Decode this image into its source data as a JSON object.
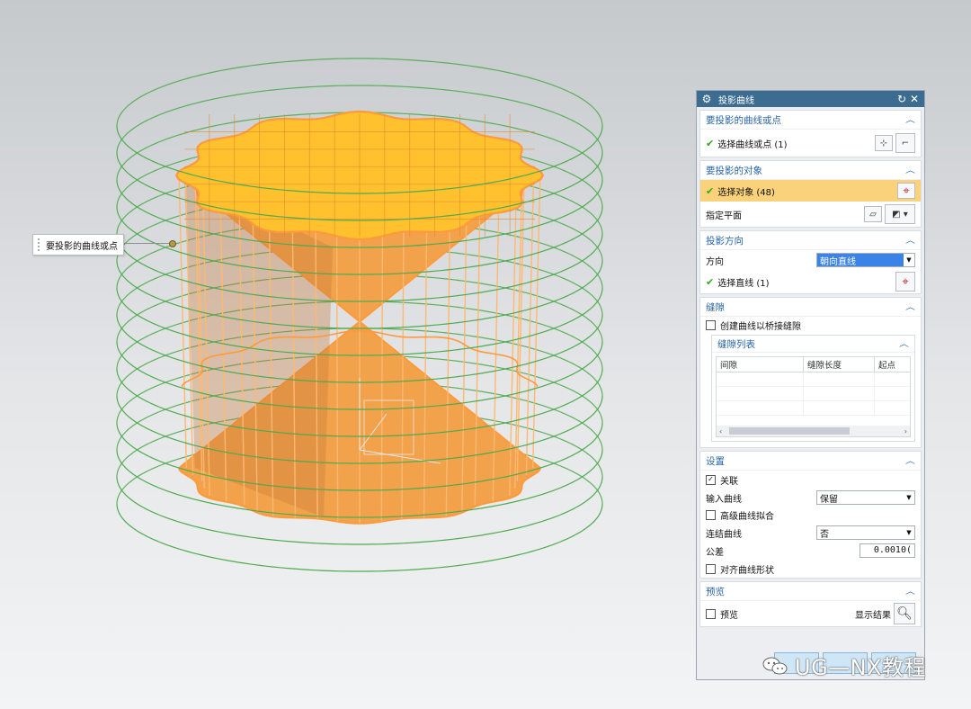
{
  "viewport": {
    "callout_label": "要投影的曲线或点",
    "colors": {
      "solid_face": "#f2a24b",
      "top_face": "#ffc12e",
      "edge": "#ff9a3c",
      "curve": "#4faa4f"
    }
  },
  "dialog": {
    "title": "投影曲线",
    "title_icons": [
      "gear-icon",
      "reset-icon",
      "close-icon"
    ],
    "groups": {
      "curves": {
        "title": "要投影的曲线或点",
        "select_label": "选择曲线或点 (1)"
      },
      "objects": {
        "title": "要投影的对象",
        "select_label": "选择对象 (48)",
        "plane_label": "指定平面"
      },
      "direction": {
        "title": "投影方向",
        "direction_label": "方向",
        "direction_value": "朝向直线",
        "select_line_label": "选择直线 (1)"
      },
      "gap": {
        "title": "缝隙",
        "create_bridge_label": "创建曲线以桥接缝隙",
        "list_title": "缝隙列表",
        "columns": [
          "间隙",
          "缝隙长度",
          "起点"
        ]
      },
      "settings": {
        "title": "设置",
        "associative_label": "关联",
        "associative_checked": true,
        "input_curves_label": "输入曲线",
        "input_curves_value": "保留",
        "advanced_fit_label": "高级曲线拟合",
        "join_curves_label": "连结曲线",
        "join_curves_value": "否",
        "tolerance_label": "公差",
        "tolerance_value": "0.0010(",
        "align_shape_label": "对齐曲线形状"
      },
      "preview": {
        "title": "预览",
        "preview_label": "预览",
        "show_result_label": "显示结果"
      }
    }
  },
  "watermark": {
    "text": "UG—NX教程"
  }
}
